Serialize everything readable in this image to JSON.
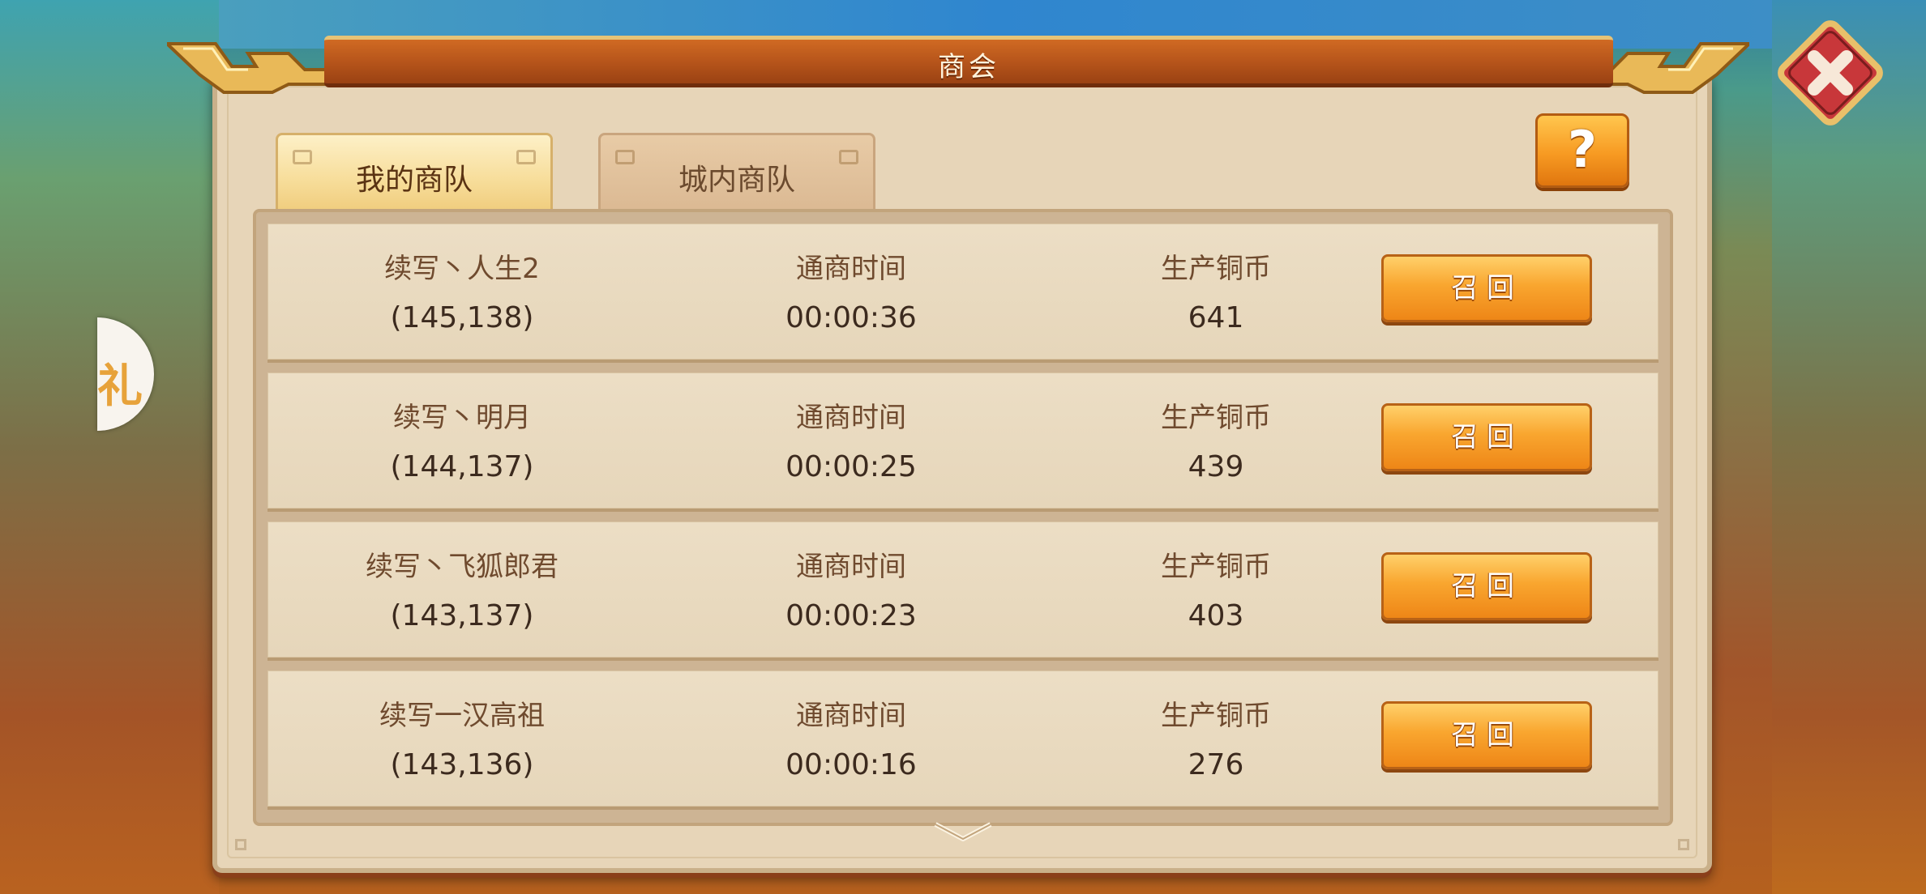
{
  "window": {
    "title": "商会"
  },
  "tabs": [
    {
      "label": "我的商队",
      "active": true
    },
    {
      "label": "城内商队",
      "active": false
    }
  ],
  "side_bubble": {
    "text": "礼"
  },
  "help": {
    "label": "?"
  },
  "close": {
    "icon": "close-x-icon"
  },
  "caravans": [
    {
      "name": "续写丶人生2",
      "coords": "(145,138)",
      "time_label": "通商时间",
      "time": "00:00:36",
      "coin_label": "生产铜币",
      "coin": "641",
      "button": "召回"
    },
    {
      "name": "续写丶明月",
      "coords": "(144,137)",
      "time_label": "通商时间",
      "time": "00:00:25",
      "coin_label": "生产铜币",
      "coin": "439",
      "button": "召回"
    },
    {
      "name": "续写丶飞狐郎君",
      "coords": "(143,137)",
      "time_label": "通商时间",
      "time": "00:00:23",
      "coin_label": "生产铜币",
      "coin": "403",
      "button": "召回"
    },
    {
      "name": "续写一汉高祖",
      "coords": "(143,136)",
      "time_label": "通商时间",
      "time": "00:00:16",
      "coin_label": "生产铜币",
      "coin": "276",
      "button": "召回"
    }
  ],
  "colors": {
    "accent": "#f39a24",
    "title_bar": "#b4531a",
    "panel": "#e7d5b8",
    "close": "#c8373a"
  }
}
